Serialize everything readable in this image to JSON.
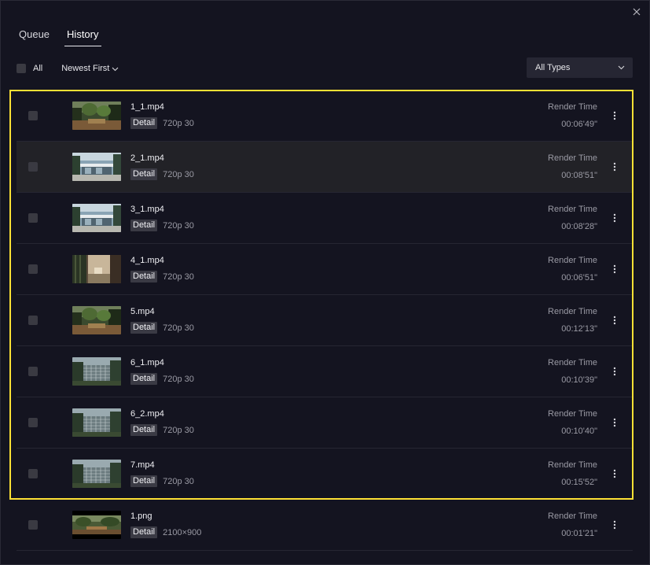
{
  "tabs": [
    {
      "label": "Queue",
      "active": false
    },
    {
      "label": "History",
      "active": true
    }
  ],
  "toolbar": {
    "select_all_label": "All",
    "sort_label": "Newest First",
    "type_filter_label": "All Types"
  },
  "render_time_label": "Render Time",
  "detail_label": "Detail",
  "items": [
    {
      "name": "1_1.mp4",
      "meta": "720p  30",
      "render_time": "00:06'49\"",
      "thumb": "forest"
    },
    {
      "name": "2_1.mp4",
      "meta": "720p  30",
      "render_time": "00:08'51\"",
      "thumb": "house",
      "hovered": true
    },
    {
      "name": "3_1.mp4",
      "meta": "720p  30",
      "render_time": "00:08'28\"",
      "thumb": "house"
    },
    {
      "name": "4_1.mp4",
      "meta": "720p  30",
      "render_time": "00:06'51\"",
      "thumb": "interior"
    },
    {
      "name": "5.mp4",
      "meta": "720p  30",
      "render_time": "00:12'13\"",
      "thumb": "forest"
    },
    {
      "name": "6_1.mp4",
      "meta": "720p  30",
      "render_time": "00:10'39\"",
      "thumb": "grid"
    },
    {
      "name": "6_2.mp4",
      "meta": "720p  30",
      "render_time": "00:10'40\"",
      "thumb": "grid"
    },
    {
      "name": "7.mp4",
      "meta": "720p  30",
      "render_time": "00:15'52\"",
      "thumb": "grid"
    },
    {
      "name": "1.png",
      "meta": "2100×900",
      "render_time": "00:01'21\"",
      "thumb": "wide"
    }
  ],
  "colors": {
    "accent_highlight": "#ffe135",
    "background": "#141420",
    "hover_row": "#222227"
  },
  "icons": {
    "close": "close-icon",
    "sort_chevron": "chevron-down-icon",
    "dropdown_chevron": "chevron-down-icon",
    "row_menu": "more-vertical-icon"
  }
}
